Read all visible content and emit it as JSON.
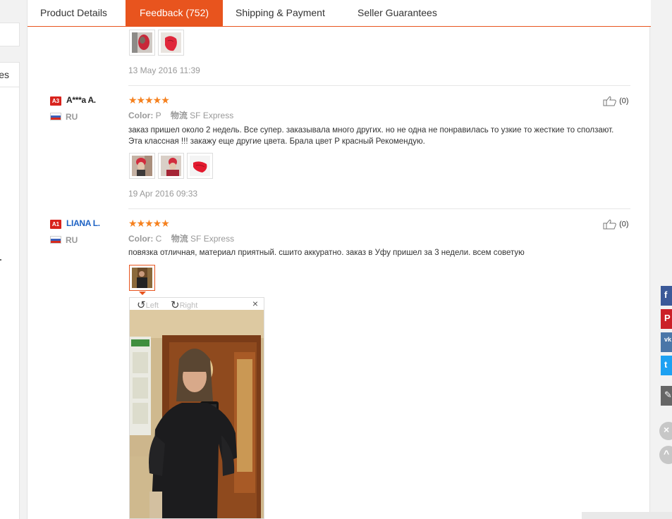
{
  "tabs": {
    "product_details": "Product Details",
    "feedback": "Feedback (752)",
    "shipping": "Shipping & Payment",
    "guarantees": "Seller Guarantees"
  },
  "left_sidebar": {
    "partial_label": "es"
  },
  "reviews": [
    {
      "date": "13 May 2016 11:39"
    },
    {
      "badge": "A3",
      "name": "A***a A.",
      "country": "RU",
      "stars": "★★★★★",
      "color_label": "Color:",
      "color_value": "P",
      "shipping_cn": "物流",
      "shipping": "SF Express",
      "text": "заказ пришел около 2 недель. Все супер. заказывала много других. но не одна не понравилась то узкие то жесткие то сползают. Эта классная !!! закажу еще другие цвета. Брала цвет P красный Рекомендую.",
      "helpful": "(0)",
      "date": "19 Apr 2016 09:33"
    },
    {
      "badge": "A1",
      "name": "LIANA L.",
      "country": "RU",
      "stars": "★★★★★",
      "color_label": "Color:",
      "color_value": "C",
      "shipping_cn": "物流",
      "shipping": "SF Express",
      "text": "повязка отличная, материал приятный. сшито аккуратно. заказ в Уфу пришел за 3 недели. всем советую",
      "helpful": "(0)"
    }
  ],
  "viewer": {
    "left": "Left",
    "right": "Right",
    "close": "×"
  },
  "share": {
    "facebook": "f",
    "pinterest": "P",
    "vk": "vk",
    "twitter": "t",
    "edit": "✎"
  },
  "colors": {
    "accent": "#e8541e",
    "star": "#f5811f",
    "badge": "#d8231d",
    "link_blue": "#1d62c4"
  }
}
